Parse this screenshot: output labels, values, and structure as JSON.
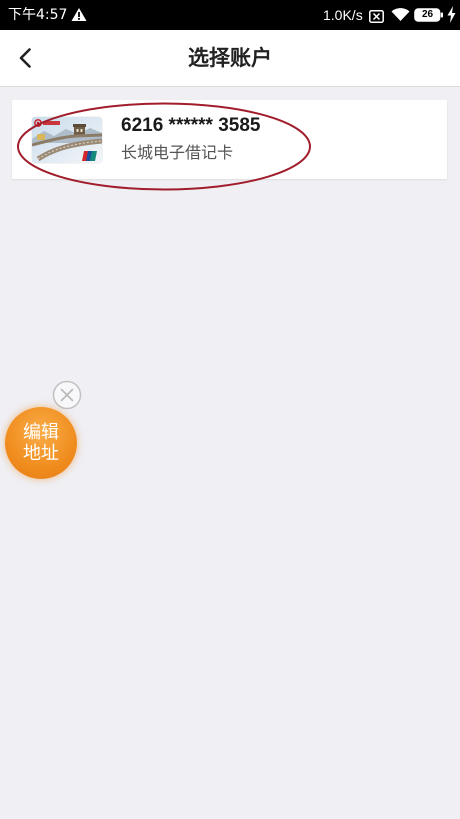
{
  "status_bar": {
    "time": "下午4:57",
    "network_speed": "1.0K/s",
    "battery_level": "26",
    "icons": [
      "warning-icon",
      "sim-blocked-icon",
      "wifi-icon",
      "battery-icon",
      "charging-icon"
    ]
  },
  "header": {
    "title": "选择账户",
    "back_icon": "chevron-left-icon"
  },
  "accounts": [
    {
      "number": "6216 ****** 3585",
      "name": "长城电子借记卡",
      "card_icon": "bank-card-icon"
    }
  ],
  "floating_button": {
    "label_lines": [
      "编辑",
      "地址"
    ],
    "close_icon": "close-circle-icon"
  },
  "colors": {
    "page_background": "#efeff4",
    "status_bar": "#000000",
    "header_background": "#ffffff",
    "card_background": "#ffffff",
    "floating_button": "#f08d1f",
    "annotation": "#a11d2b",
    "primary_text": "#1a1a1a",
    "secondary_text": "#555555"
  }
}
